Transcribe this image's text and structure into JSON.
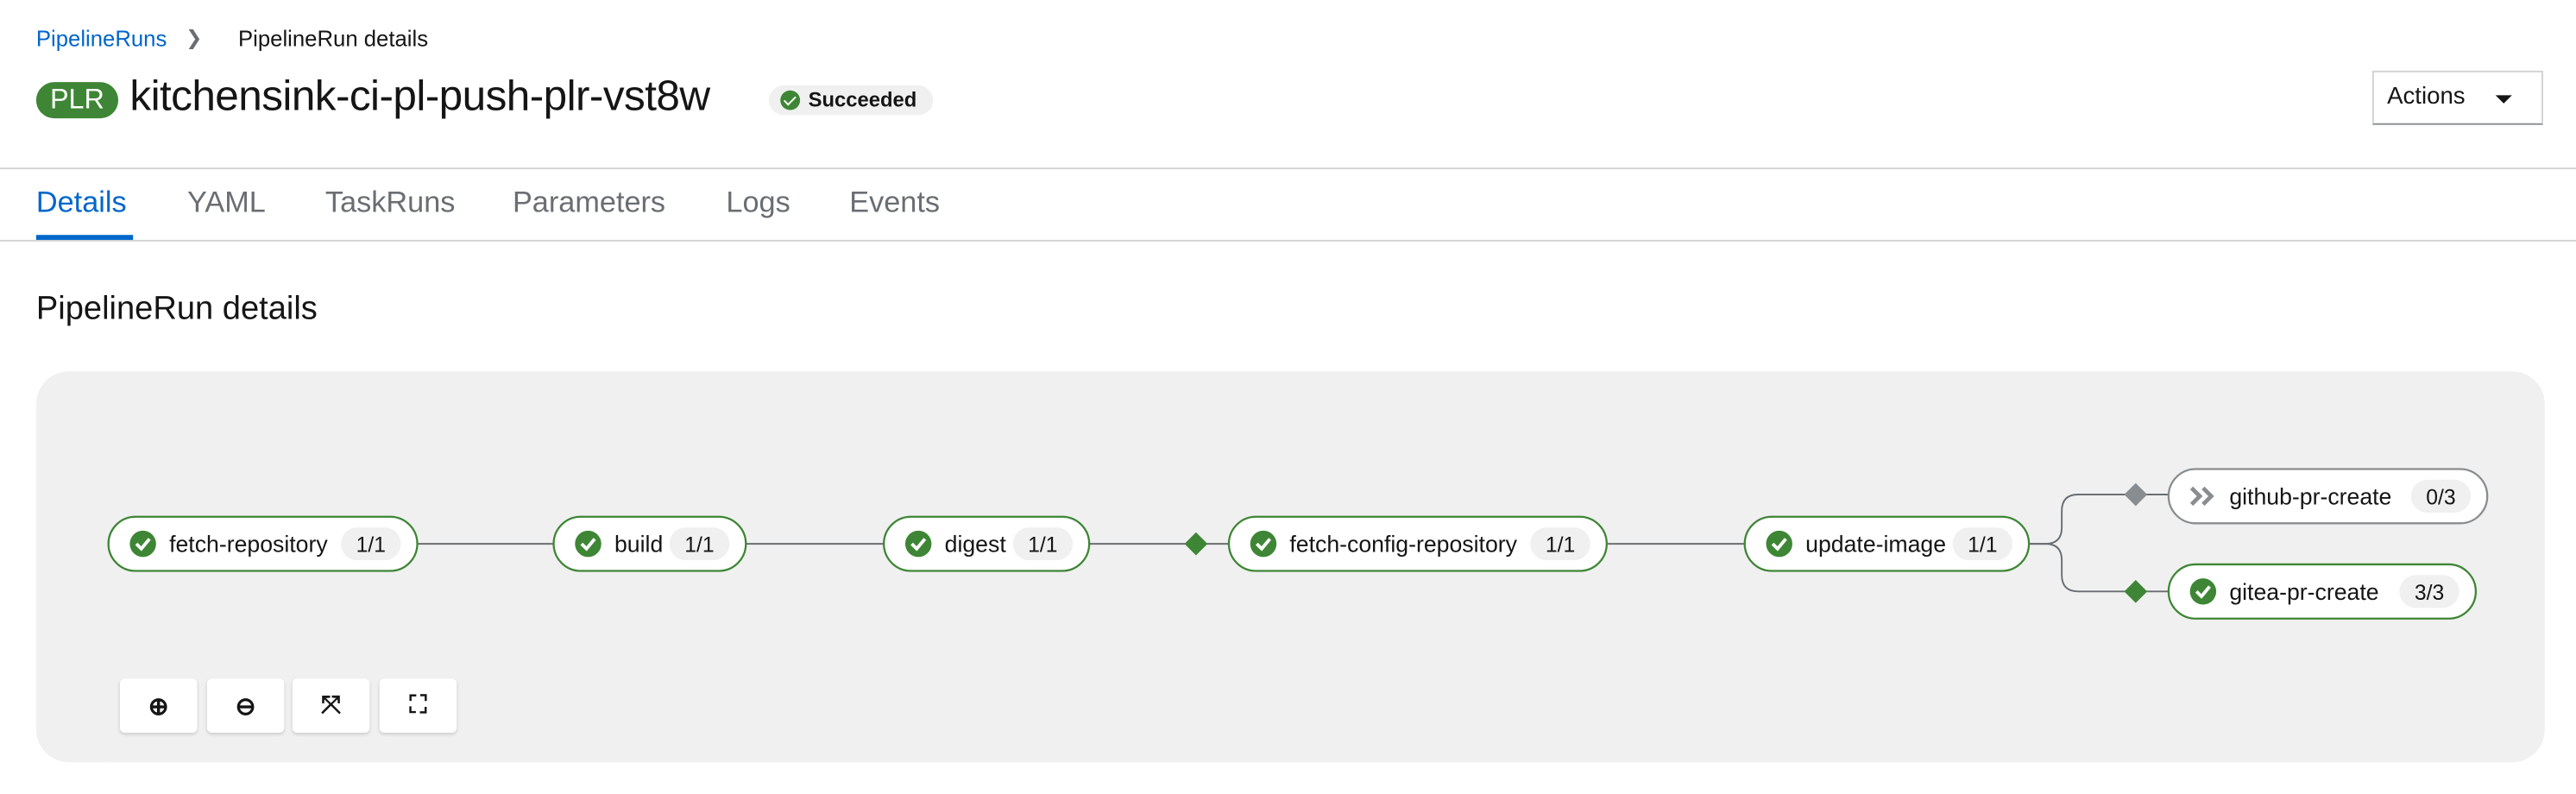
{
  "breadcrumb": {
    "parent": "PipelineRuns",
    "current": "PipelineRun details"
  },
  "header": {
    "badge": "PLR",
    "title": "kitchensink-ci-pl-push-plr-vst8w",
    "status": "Succeeded",
    "actions_label": "Actions"
  },
  "tabs": [
    {
      "label": "Details",
      "active": true
    },
    {
      "label": "YAML"
    },
    {
      "label": "TaskRuns"
    },
    {
      "label": "Parameters"
    },
    {
      "label": "Logs"
    },
    {
      "label": "Events"
    }
  ],
  "section_title": "PipelineRun details",
  "colors": {
    "success": "#3e8635",
    "pending": "#8a8d90",
    "link": "#0066cc"
  },
  "pipeline": {
    "tasks": [
      {
        "name": "fetch-repository",
        "count": "1/1",
        "status": "succeeded"
      },
      {
        "name": "build",
        "count": "1/1",
        "status": "succeeded"
      },
      {
        "name": "digest",
        "count": "1/1",
        "status": "succeeded"
      },
      {
        "name": "fetch-config-repository",
        "count": "1/1",
        "status": "succeeded"
      },
      {
        "name": "update-image",
        "count": "1/1",
        "status": "succeeded"
      },
      {
        "name": "github-pr-create",
        "count": "0/3",
        "status": "skipped"
      },
      {
        "name": "gitea-pr-create",
        "count": "3/3",
        "status": "succeeded"
      }
    ]
  },
  "controls": [
    {
      "icon": "zoom-in-icon",
      "glyph": "⊕"
    },
    {
      "icon": "zoom-out-icon",
      "glyph": "⊖"
    },
    {
      "icon": "fit-to-screen-icon",
      "glyph": "⤧"
    },
    {
      "icon": "reset-view-icon",
      "glyph": "⛶"
    }
  ]
}
